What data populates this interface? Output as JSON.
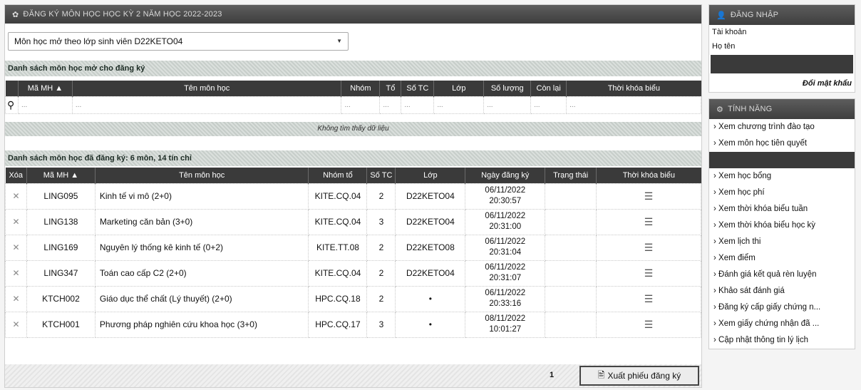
{
  "main": {
    "title": "ĐĂNG KÝ MÔN HỌC HỌC KỲ 2 NĂM HỌC 2022-2023",
    "select_value": "Môn học mở theo lớp sinh viên D22KETO04",
    "open_section": "Danh sách môn học mở cho đăng ký",
    "open_columns": [
      "Mã MH ▲",
      "Tên môn học",
      "Nhóm",
      "Tổ",
      "Số TC",
      "Lớp",
      "Số lượng",
      "Còn lại",
      "Thời khóa biểu"
    ],
    "filter_placeholder": "...",
    "empty_message": "Không tìm thấy dữ liệu",
    "registered_section": "Danh sách môn học đã đăng ký:  6 môn, 14 tín chỉ",
    "reg_columns": [
      "Xóa",
      "Mã MH ▲",
      "Tên môn học",
      "Nhóm tổ",
      "Số TC",
      "Lớp",
      "Ngày đăng ký",
      "Trạng thái",
      "Thời khóa biểu"
    ],
    "rows": [
      {
        "del": "✕",
        "code": "LING095",
        "name": "Kinh tế vi mô (2+0)",
        "group": "KITE.CQ.04",
        "credits": "2",
        "cls": "D22KETO04",
        "date": "06/11/2022",
        "time": "20:30:57",
        "status": "",
        "sched": "☰"
      },
      {
        "del": "✕",
        "code": "LING138",
        "name": "Marketing căn bản (3+0)",
        "group": "KITE.CQ.04",
        "credits": "3",
        "cls": "D22KETO04",
        "date": "06/11/2022",
        "time": "20:31:00",
        "status": "",
        "sched": "☰"
      },
      {
        "del": "✕",
        "code": "LING169",
        "name": "Nguyên lý thống kê kinh tế (0+2)",
        "group": "KITE.TT.08",
        "credits": "2",
        "cls": "D22KETO08",
        "date": "06/11/2022",
        "time": "20:31:04",
        "status": "",
        "sched": "☰"
      },
      {
        "del": "✕",
        "code": "LING347",
        "name": "Toán cao cấp C2 (2+0)",
        "group": "KITE.CQ.04",
        "credits": "2",
        "cls": "D22KETO04",
        "date": "06/11/2022",
        "time": "20:31:07",
        "status": "",
        "sched": "☰"
      },
      {
        "del": "✕",
        "code": "KTCH002",
        "name": "Giáo dục thể chất (Lý thuyết) (2+0)",
        "group": "HPC.CQ.18",
        "credits": "2",
        "cls": "•",
        "date": "06/11/2022",
        "time": "20:33:16",
        "status": "",
        "sched": "☰"
      },
      {
        "del": "✕",
        "code": "KTCH001",
        "name": "Phương pháp nghiên cứu khoa học (3+0)",
        "group": "HPC.CQ.17",
        "credits": "3",
        "cls": "•",
        "date": "08/11/2022",
        "time": "10:01:27",
        "status": "",
        "sched": "☰"
      }
    ],
    "page": "1",
    "export_label": "Xuất phiếu đăng ký"
  },
  "login": {
    "title": "ĐĂNG NHẬP",
    "account_label": "Tài khoản",
    "name_label": "Họ tên",
    "change_password": "Đổi mật khẩu"
  },
  "features": {
    "title": "TÍNH NĂNG",
    "items": [
      "Xem chương trình đào tạo",
      "Xem môn học tiên quyết",
      "",
      "Xem học bổng",
      "Xem học phí",
      "Xem thời khóa biểu tuần",
      "Xem thời khóa biểu học kỳ",
      "Xem lịch thi",
      "Xem điểm",
      "Đánh giá kết quả rèn luyện",
      "Khảo sát đánh giá",
      "Đăng ký cấp giấy chứng n...",
      "Xem giấy chứng nhận đã ...",
      "Cập nhật thông tin lý lịch"
    ]
  }
}
